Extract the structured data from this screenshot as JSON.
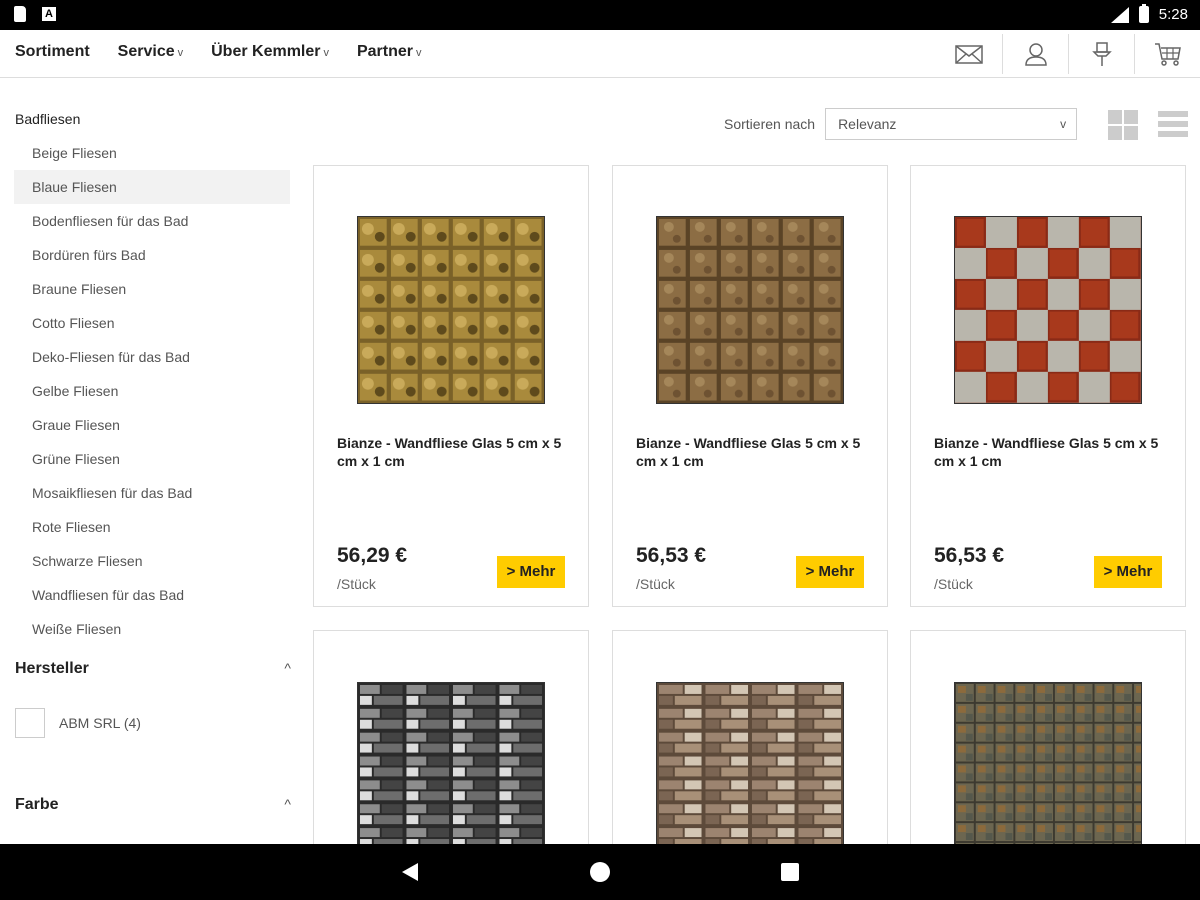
{
  "status": {
    "time": "5:28"
  },
  "nav": {
    "links": [
      {
        "label": "Sortiment",
        "chevron": ""
      },
      {
        "label": "Service",
        "chevron": "v"
      },
      {
        "label": "Über Kemmler",
        "chevron": "v"
      },
      {
        "label": "Partner",
        "chevron": "v"
      }
    ]
  },
  "sidebar": {
    "category_title": "Badfliesen",
    "categories": [
      "Beige Fliesen",
      "Blaue Fliesen",
      "Bodenfliesen für das Bad",
      "Bordüren fürs Bad",
      "Braune Fliesen",
      "Cotto Fliesen",
      "Deko-Fliesen für das Bad",
      "Gelbe Fliesen",
      "Graue Fliesen",
      "Grüne Fliesen",
      "Mosaikfliesen für das Bad",
      "Rote Fliesen",
      "Schwarze Fliesen",
      "Wandfliesen für das Bad",
      "Weiße Fliesen"
    ],
    "active_index": 1,
    "facets": [
      {
        "title": "Hersteller",
        "caret": "^"
      },
      {
        "title": "Farbe",
        "caret": "^"
      }
    ],
    "manufacturer_option": "ABM SRL (4)"
  },
  "sort": {
    "label": "Sortieren nach",
    "value": "Relevanz",
    "arrow": "v"
  },
  "products": [
    {
      "name": "Bianze - Wandfliese Glas 5 cm x 5 cm x 1 cm",
      "price": "56,29 €",
      "unit": "/Stück",
      "button": "> Mehr"
    },
    {
      "name": "Bianze - Wandfliese Glas 5 cm x 5 cm x 1 cm",
      "price": "56,53 €",
      "unit": "/Stück",
      "button": "> Mehr"
    },
    {
      "name": "Bianze - Wandfliese Glas 5 cm x 5 cm x 1 cm",
      "price": "56,53 €",
      "unit": "/Stück",
      "button": "> Mehr"
    }
  ],
  "colors": {
    "accent": "#ffcc00"
  }
}
